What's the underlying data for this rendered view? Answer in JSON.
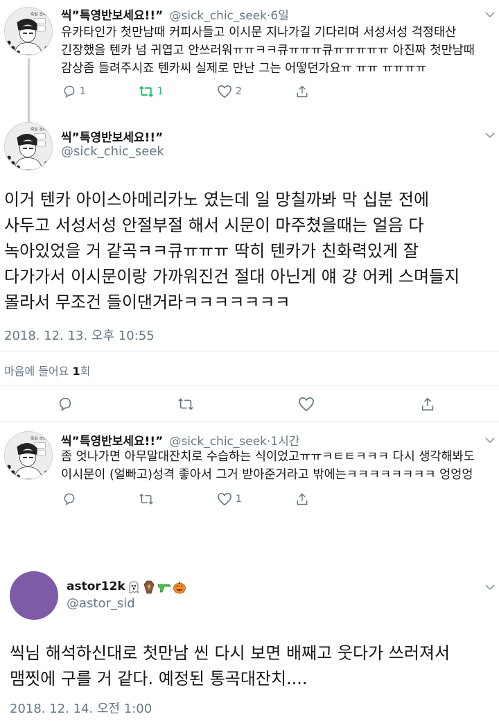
{
  "tweet1": {
    "name": "씩”특영반보세요!!”",
    "handle": "@sick_chic_seek",
    "time": "·6일",
    "lines": [
      "유카타인가 첫만남때 커피사들고 이시문 지나가길 기다리며 서성서성 걱정태산",
      "긴장했을 텐카 넘 귀엽고 안쓰러워ㅠㅠㅋㅋ큐ㅠㅠㅠ큐ㅠㅠㅠㅠㅠ 아진짜 첫만남때",
      "감상좀 들려주시죠 텐카씨 실제로 만난 그는 어떻던가요ㅠ ㅠㅠ ㅠㅠㅠㅠ"
    ],
    "reply_count": "1",
    "retweet_count": "1",
    "like_count": "2"
  },
  "tweet2": {
    "name": "씩”특영반보세요!!”",
    "handle": "@sick_chic_seek",
    "lines": [
      "이거 텐카 아이스아메리카노 였는데 일 망칠까봐 막 십분 전에",
      "사두고 서성서성 안절부절 해서 시문이 마주쳤을때는 얼음 다",
      "녹아있었을 거 같곡ㅋㅋ큐ㅠㅠㅠ 딱히 텐카가 친화력있게 잘",
      "다가가서 이시문이랑 가까워진건 절대 아닌게 얘 걍 어케 스며들지",
      "몰라서 무조건 들이댄거라ㅋㅋㅋㅋㅋㅋㅋ"
    ],
    "timestamp": "2018. 12. 13. 오후 10:55",
    "likes_prefix": "마음에 들어요 ",
    "likes_count": "1",
    "likes_suffix": "회"
  },
  "tweet3": {
    "name": "씩”특영반보세요!!”",
    "handle": "@sick_chic_seek",
    "time": "·1시간",
    "lines": [
      "좀 엇나가면 아무말대잔치로 수습하는 식이었고ㅠㅠㅋㅌㅌㅋㅋㅋ 다시 생각해봐도",
      "이시문이 (얼빠고)성격 좋아서 그거 받아준거라고 밖에는ㅋㅋㅋㅋㅋㅋㅋㅋ 엉엉엉"
    ],
    "like_count": "1"
  },
  "tweet4": {
    "name": "astor12k",
    "handle": "@astor_sid",
    "name_emojis": [
      "ghost-emoji",
      "coffin-emoji",
      "water-pistol-emoji",
      "jack-o-lantern-emoji"
    ],
    "lines": [
      "씩님 해석하신대로 첫만남 씬 다시 보면 배째고 웃다가 쓰러져서",
      "맴찟에 구를 거 같다. 예정된 통곡대잔치...."
    ],
    "timestamp": "2018. 12. 14. 오전 1:00"
  },
  "avatar_text": "죽일 것이다",
  "colors": {
    "text": "#14171a",
    "secondary": "#657786",
    "retweet_green": "#17bf63",
    "divider": "#e1e8ed",
    "purple_avatar": "#7d5ba6"
  }
}
